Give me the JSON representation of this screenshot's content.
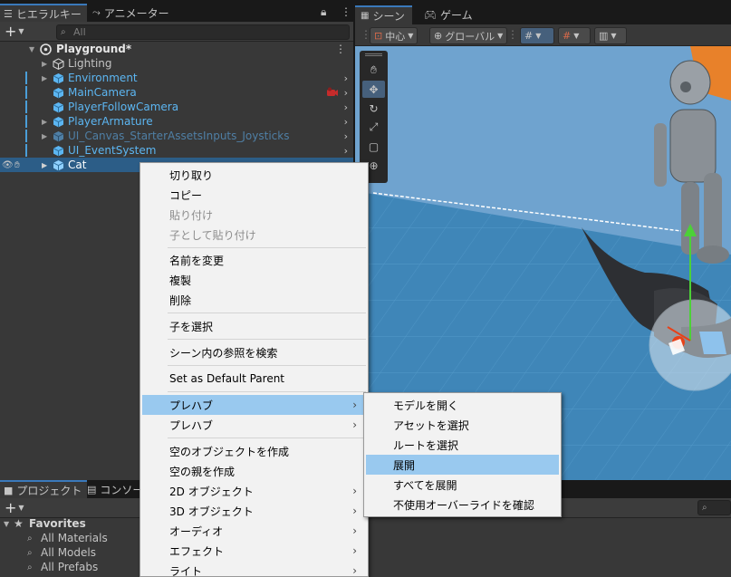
{
  "hierarchy": {
    "tab_label": "ヒエラルキー",
    "other_tab_label": "アニメーター",
    "search_placeholder": "All",
    "scene_name": "Playground*",
    "items": [
      {
        "label": "Lighting",
        "style": "normal",
        "expand": true
      },
      {
        "label": "Environment",
        "style": "blue",
        "expand": true,
        "chevron": true
      },
      {
        "label": "MainCamera",
        "style": "blue",
        "expand": false,
        "chevron": true,
        "warning": true
      },
      {
        "label": "PlayerFollowCamera",
        "style": "blue",
        "expand": false,
        "chevron": true
      },
      {
        "label": "PlayerArmature",
        "style": "blue",
        "expand": true,
        "chevron": true
      },
      {
        "label": "UI_Canvas_StarterAssetsInputs_Joysticks",
        "style": "dim",
        "expand": true,
        "chevron": true
      },
      {
        "label": "UI_EventSystem",
        "style": "blue",
        "expand": false,
        "chevron": true
      },
      {
        "label": "Cat",
        "style": "selected",
        "expand": true
      }
    ]
  },
  "scene": {
    "tab_label": "シーン",
    "game_tab_label": "ゲーム",
    "pivot_label": "中心",
    "space_label": "グローバル",
    "colors": {
      "sky": "#6fa3cf",
      "floor": "#3f86b8",
      "wall": "#e8812a"
    }
  },
  "project": {
    "tab_label": "プロジェクト",
    "console_tab_label": "コンソール",
    "favorites_label": "Favorites",
    "favorites": [
      "All Materials",
      "All Models",
      "All Prefabs"
    ]
  },
  "context_menu": {
    "items": [
      {
        "label": "切り取り",
        "state": "normal"
      },
      {
        "label": "コピー",
        "state": "normal"
      },
      {
        "label": "貼り付け",
        "state": "disabled"
      },
      {
        "label": "子として貼り付け",
        "state": "disabled"
      },
      {
        "label": "名前を変更",
        "state": "normal"
      },
      {
        "label": "複製",
        "state": "normal"
      },
      {
        "label": "削除",
        "state": "normal"
      },
      {
        "label": "子を選択",
        "state": "normal"
      },
      {
        "label": "シーン内の参照を検索",
        "state": "normal"
      },
      {
        "label": "Set as Default Parent",
        "state": "normal"
      },
      {
        "label": "プレハブ",
        "state": "highlighted",
        "submenu": true
      },
      {
        "label": "プレハブ",
        "state": "normal",
        "submenu": true
      },
      {
        "label": "空のオブジェクトを作成",
        "state": "normal"
      },
      {
        "label": "空の親を作成",
        "state": "normal"
      },
      {
        "label": "2D オブジェクト",
        "state": "normal",
        "submenu": true
      },
      {
        "label": "3D オブジェクト",
        "state": "normal",
        "submenu": true
      },
      {
        "label": "オーディオ",
        "state": "normal",
        "submenu": true
      },
      {
        "label": "エフェクト",
        "state": "normal",
        "submenu": true
      },
      {
        "label": "ライト",
        "state": "normal",
        "submenu": true
      }
    ]
  },
  "prefab_submenu": {
    "items": [
      {
        "label": "モデルを開く",
        "state": "normal"
      },
      {
        "label": "アセットを選択",
        "state": "normal"
      },
      {
        "label": "ルートを選択",
        "state": "normal"
      },
      {
        "label": "展開",
        "state": "highlighted"
      },
      {
        "label": "すべてを展開",
        "state": "normal"
      },
      {
        "label": "不使用オーバーライドを確認",
        "state": "normal"
      }
    ]
  }
}
